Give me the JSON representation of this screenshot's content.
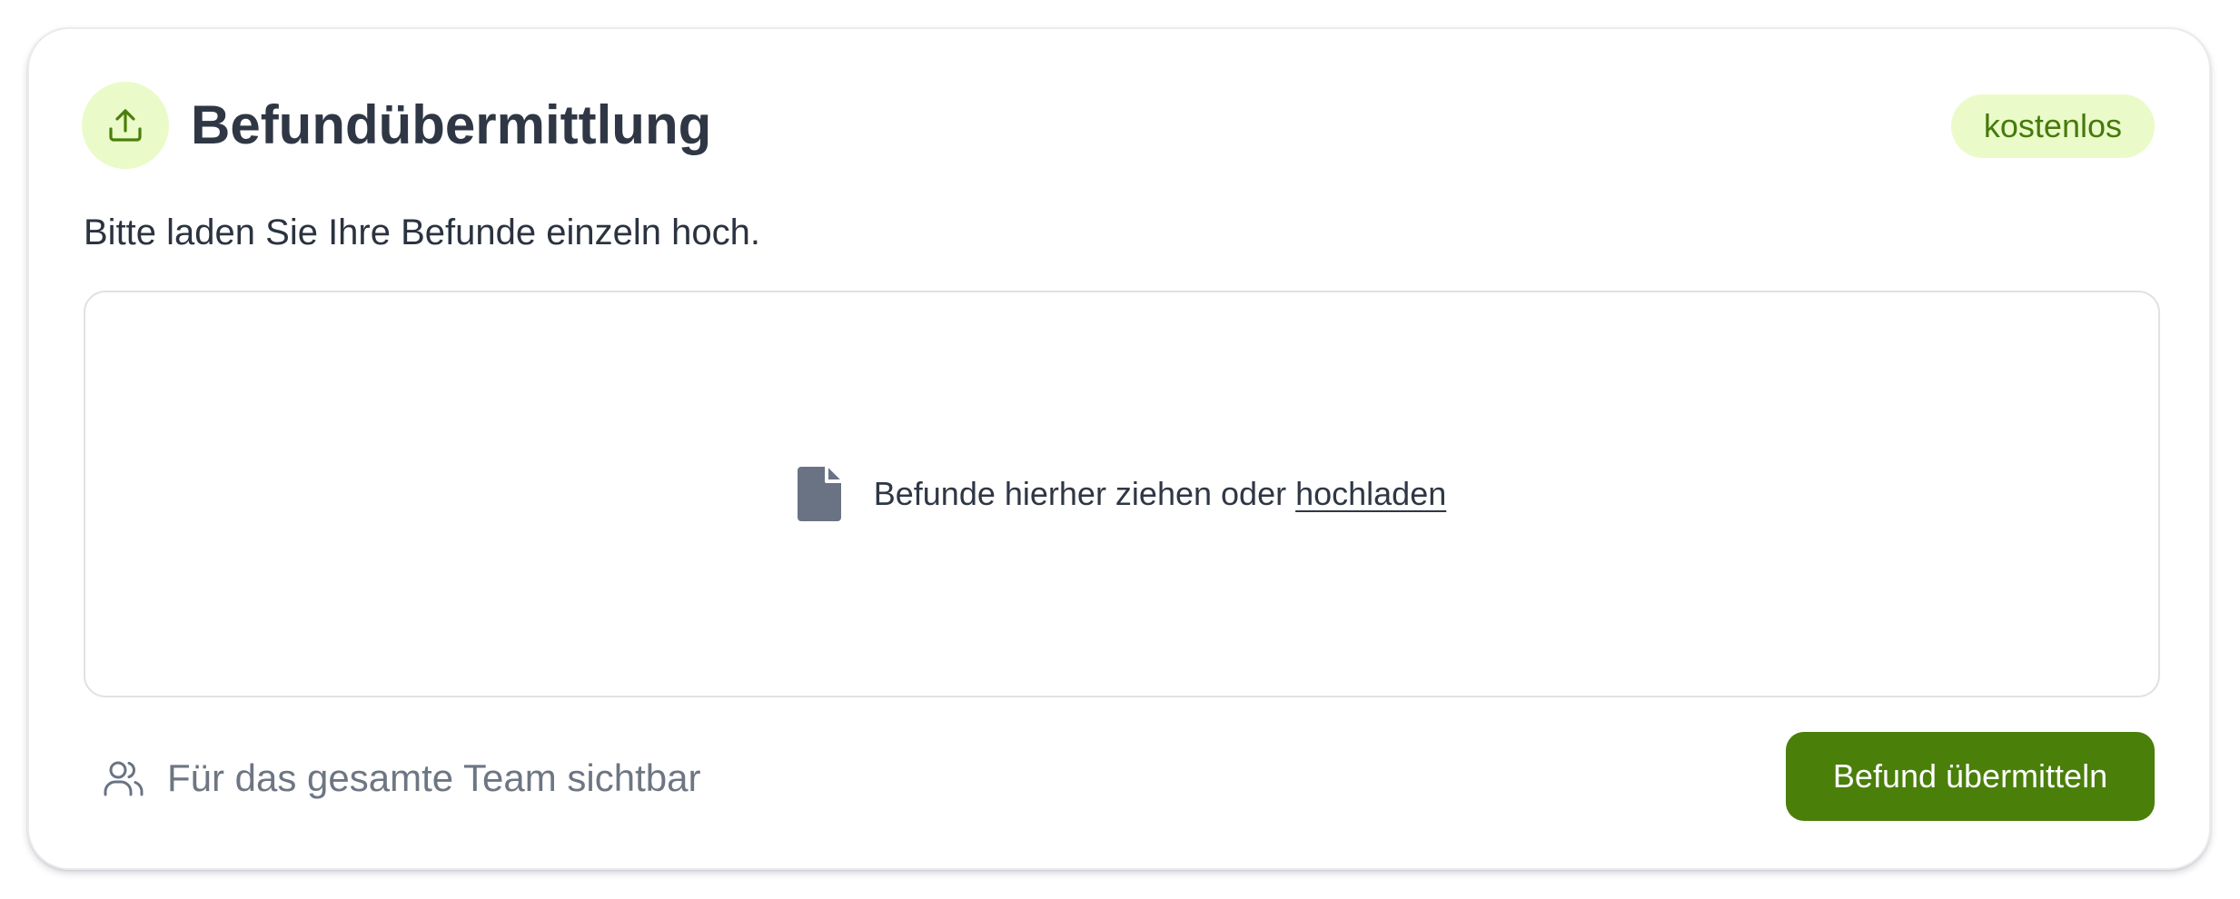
{
  "card": {
    "title": "Befundübermittlung",
    "badge": "kostenlos",
    "subtitle": "Bitte laden Sie Ihre Befunde einzeln hoch.",
    "header_icon": "upload-icon"
  },
  "dropzone": {
    "icon": "file-icon",
    "text": "Befunde hierher ziehen oder",
    "link": "hochladen"
  },
  "footer": {
    "visibility_icon": "users-icon",
    "visibility_label": "Für das gesamte Team sichtbar",
    "submit_label": "Befund übermitteln"
  },
  "colors": {
    "accent": "#4a7f0a",
    "accent_light": "#eafbc9",
    "badge_text": "#467a0b",
    "title": "#2f3745",
    "muted": "#6d7683"
  }
}
